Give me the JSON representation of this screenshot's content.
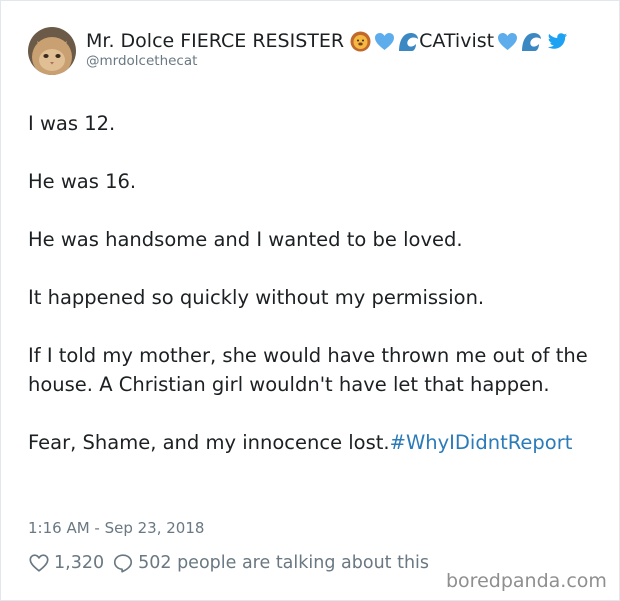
{
  "author": {
    "name": "Mr. Dolce FIERCE RESISTER",
    "name_suffix": "CATivist",
    "handle": "@mrdolcethecat",
    "avatar_icon": "cat-avatar"
  },
  "name_emojis": [
    "lion-face-icon",
    "blue-heart-icon",
    "wave-icon",
    "blue-heart-icon",
    "wave-icon"
  ],
  "platform_icon": "twitter-bird-icon",
  "tweet": {
    "paragraphs": [
      "I was 12.",
      "He was 16.",
      "He was handsome and I wanted to be loved.",
      "It happened so quickly without my permission.",
      "If I told my mother, she would have thrown me out of the house. A Christian girl wouldn't have let that happen."
    ],
    "last_paragraph_text": "Fear, Shame, and my innocence lost.",
    "hashtag": "#WhyIDidntReport",
    "timestamp": "1:16 AM - Sep 23, 2018"
  },
  "actions": {
    "likes": "1,320",
    "replies_text": "502 people are talking about this"
  },
  "watermark": "boredpanda.com",
  "colors": {
    "text": "#1c2022",
    "muted": "#697882",
    "link": "#2b7bb9",
    "twitter_blue": "#1da1f2",
    "heart_blue": "#5dadec"
  }
}
